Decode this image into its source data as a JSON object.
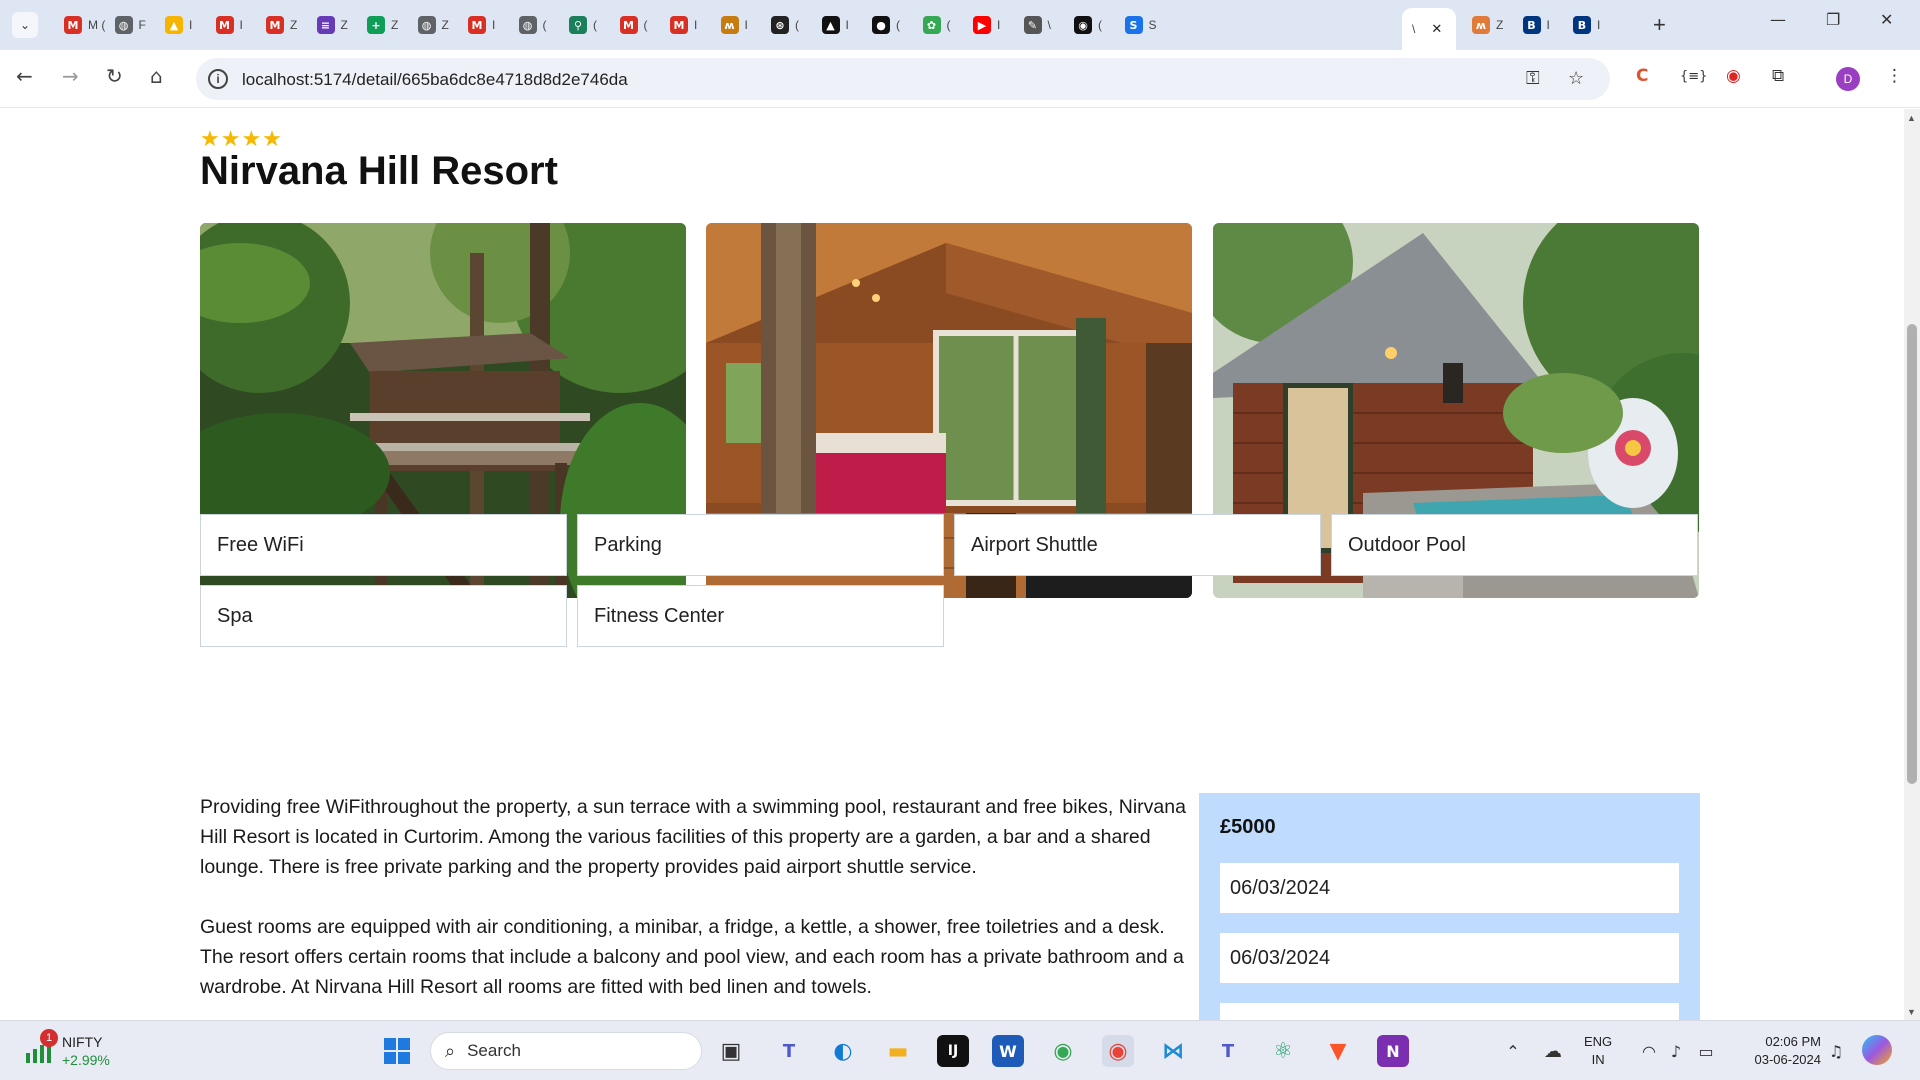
{
  "browser": {
    "tabs": [
      {
        "label": "M (",
        "icon": "gmail-icon",
        "color": "#d93025"
      },
      {
        "label": "F",
        "icon": "globe-icon",
        "color": "#5f6368"
      },
      {
        "label": "I",
        "icon": "drive-icon",
        "color": "#f4b400"
      },
      {
        "label": "I",
        "icon": "gmail-icon",
        "color": "#d93025"
      },
      {
        "label": "Z",
        "icon": "gmail-icon",
        "color": "#d93025"
      },
      {
        "label": "Z",
        "icon": "forms-icon",
        "color": "#673ab7"
      },
      {
        "label": "Z",
        "icon": "sheets-icon",
        "color": "#0f9d58"
      },
      {
        "label": "Z",
        "icon": "globe-icon",
        "color": "#5f6368"
      },
      {
        "label": "I",
        "icon": "gmail-icon",
        "color": "#d93025"
      },
      {
        "label": "(",
        "icon": "globe-icon",
        "color": "#5f6368"
      },
      {
        "label": "(",
        "icon": "badge-icon",
        "color": "#1a7f5a"
      },
      {
        "label": "(",
        "icon": "gmail-icon",
        "color": "#d93025"
      },
      {
        "label": "I",
        "icon": "gmail-icon",
        "color": "#d93025"
      },
      {
        "label": "I",
        "icon": "app-icon",
        "color": "#c77c12"
      },
      {
        "label": "(",
        "icon": "openai-icon",
        "color": "#222222"
      },
      {
        "label": "I",
        "icon": "triangle-icon",
        "color": "#111111"
      },
      {
        "label": "(",
        "icon": "circle-icon",
        "color": "#111111"
      },
      {
        "label": "(",
        "icon": "map-icon",
        "color": "#34a853"
      },
      {
        "label": "I",
        "icon": "youtube-icon",
        "color": "#ff0000"
      },
      {
        "label": "\\",
        "icon": "edit-icon",
        "color": "#555555"
      },
      {
        "label": "(",
        "icon": "github-icon",
        "color": "#111111"
      },
      {
        "label": "S",
        "icon": "s-icon",
        "color": "#1a73e8"
      }
    ],
    "active_tab": {
      "label": "\\",
      "close_symbol": "✕"
    },
    "trailing_tabs": [
      {
        "label": "Z",
        "icon": "app-icon",
        "color": "#e07b39"
      },
      {
        "label": "I",
        "icon": "booking-icon",
        "color": "#003580"
      },
      {
        "label": "I",
        "icon": "booking-icon",
        "color": "#003580"
      }
    ],
    "url": "localhost:5174/detail/665ba6dc8e4718d8d2e746da"
  },
  "hotel": {
    "star_rating": 4,
    "stars_display": "★★★★",
    "name": "Nirvana Hill Resort",
    "facilities": [
      "Free WiFi",
      "Parking",
      "Airport Shuttle",
      "Outdoor Pool",
      "Spa",
      "Fitness Center"
    ],
    "description": [
      "Providing free WiFithroughout the property, a sun terrace with a swimming pool, restaurant and free bikes, Nirvana Hill Resort is located in Curtorim. Among the various facilities of this property are a garden, a bar and a shared lounge. There is free private parking and the property provides paid airport shuttle service.",
      "Guest rooms are equipped with air conditioning, a minibar, a fridge, a kettle, a shower, free toiletries and a desk. The resort offers certain rooms that include a balcony and pool view, and each room has a private bathroom and a wardrobe. At Nirvana Hill Resort all rooms are fitted with bed linen and towels."
    ],
    "booking": {
      "price": "£5000",
      "check_in": "06/03/2024",
      "check_out": "06/03/2024"
    }
  },
  "taskbar": {
    "widget": {
      "badge": "1",
      "name": "NIFTY",
      "change": "+2.99%"
    },
    "search_placeholder": "Search",
    "language": "ENG",
    "region": "IN",
    "time": "02:06 PM",
    "date": "03-06-2024"
  },
  "colors": {
    "star": "#f6b800",
    "booking_panel": "#bfdbfe",
    "facility_border": "#cbd5e1"
  }
}
